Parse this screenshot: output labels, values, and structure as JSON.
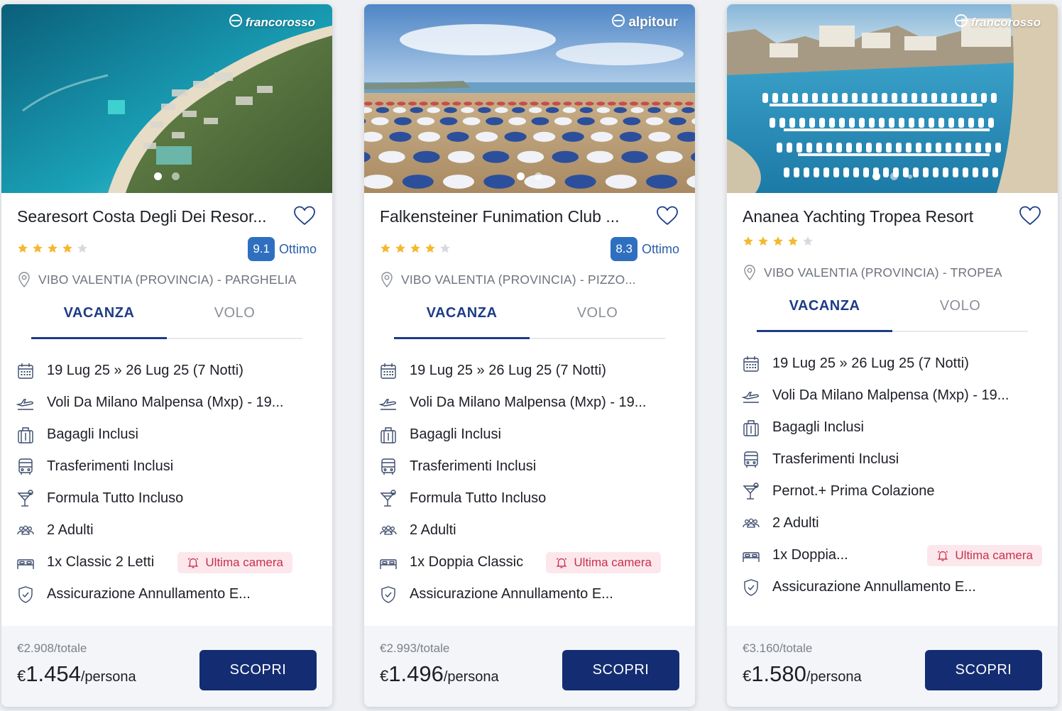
{
  "cards": [
    {
      "brand": "francorosso",
      "title": "Searesort Costa Degli Dei Resor...",
      "stars_filled": 4,
      "stars_total": 5,
      "score": "9.1",
      "score_label": "Ottimo",
      "location": "VIBO VALENTIA (PROVINCIA) - PARGHELIA",
      "tabs": [
        "VACANZA",
        "VOLO"
      ],
      "active_tab": 0,
      "features": [
        {
          "icon": "calendar-icon",
          "text": "19 Lug 25 » 26 Lug 25 (7 Notti)"
        },
        {
          "icon": "plane-icon",
          "text": "Voli Da Milano Malpensa (Mxp) - 19..."
        },
        {
          "icon": "luggage-icon",
          "text": "Bagagli Inclusi"
        },
        {
          "icon": "bus-icon",
          "text": "Trasferimenti Inclusi"
        },
        {
          "icon": "cocktail-icon",
          "text": "Formula Tutto Incluso"
        },
        {
          "icon": "people-icon",
          "text": "2 Adulti"
        },
        {
          "icon": "bed-icon",
          "text": "1x Classic 2 Letti",
          "badge": "Ultima camera"
        },
        {
          "icon": "shield-icon",
          "text": "Assicurazione Annullamento E..."
        }
      ],
      "price_total": "€2.908",
      "price_total_unit": "/totale",
      "price_currency": "€",
      "price_person": "1.454",
      "price_person_unit": "/persona",
      "cta": "SCOPRI",
      "photo_dots": 2,
      "photo_active": 0
    },
    {
      "brand": "alpitour",
      "title": "Falkensteiner Funimation Club ...",
      "stars_filled": 4,
      "stars_total": 5,
      "score": "8.3",
      "score_label": "Ottimo",
      "location": "VIBO VALENTIA (PROVINCIA) - PIZZO...",
      "tabs": [
        "VACANZA",
        "VOLO"
      ],
      "active_tab": 0,
      "features": [
        {
          "icon": "calendar-icon",
          "text": "19 Lug 25 » 26 Lug 25 (7 Notti)"
        },
        {
          "icon": "plane-icon",
          "text": "Voli Da Milano Malpensa (Mxp) - 19..."
        },
        {
          "icon": "luggage-icon",
          "text": "Bagagli Inclusi"
        },
        {
          "icon": "bus-icon",
          "text": "Trasferimenti Inclusi"
        },
        {
          "icon": "cocktail-icon",
          "text": "Formula Tutto Incluso"
        },
        {
          "icon": "people-icon",
          "text": "2 Adulti"
        },
        {
          "icon": "bed-icon",
          "text": "1x Doppia Classic",
          "badge": "Ultima camera"
        },
        {
          "icon": "shield-icon",
          "text": "Assicurazione Annullamento E..."
        }
      ],
      "price_total": "€2.993",
      "price_total_unit": "/totale",
      "price_currency": "€",
      "price_person": "1.496",
      "price_person_unit": "/persona",
      "cta": "SCOPRI",
      "photo_dots": 2,
      "photo_active": 0
    },
    {
      "brand": "francorosso",
      "title": "Ananea Yachting Tropea Resort",
      "stars_filled": 4,
      "stars_total": 5,
      "score": "",
      "score_label": "",
      "location": "VIBO VALENTIA (PROVINCIA) - TROPEA",
      "tabs": [
        "VACANZA",
        "VOLO"
      ],
      "active_tab": 0,
      "features": [
        {
          "icon": "calendar-icon",
          "text": "19 Lug 25 » 26 Lug 25 (7 Notti)"
        },
        {
          "icon": "plane-icon",
          "text": "Voli Da Milano Malpensa (Mxp) - 19..."
        },
        {
          "icon": "luggage-icon",
          "text": "Bagagli Inclusi"
        },
        {
          "icon": "bus-icon",
          "text": "Trasferimenti Inclusi"
        },
        {
          "icon": "cocktail-icon",
          "text": "Pernot.+ Prima Colazione"
        },
        {
          "icon": "people-icon",
          "text": "2 Adulti"
        },
        {
          "icon": "bed-icon",
          "text": "1x Doppia...",
          "badge": "Ultima camera"
        },
        {
          "icon": "shield-icon",
          "text": "Assicurazione Annullamento E..."
        }
      ],
      "price_total": "€3.160",
      "price_total_unit": "/totale",
      "price_currency": "€",
      "price_person": "1.580",
      "price_person_unit": "/persona",
      "cta": "SCOPRI",
      "photo_dots": 3,
      "photo_active": 0
    }
  ],
  "colors": {
    "primary": "#142d72",
    "tab_active": "#1d3c87",
    "score_bg": "#2f6fbf",
    "star": "#f5b82e",
    "badge_bg": "#fce8ec",
    "badge_text": "#c8304d",
    "icon": "#3a4a6b"
  }
}
